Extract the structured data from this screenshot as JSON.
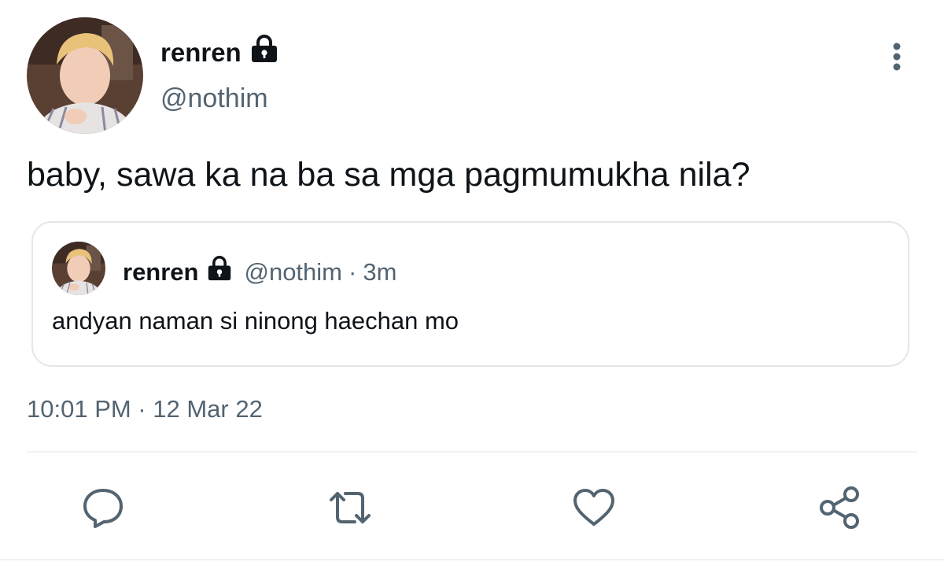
{
  "tweet": {
    "author": {
      "display_name": "renren",
      "handle": "@nothim",
      "protected_icon": "lock-icon"
    },
    "text": "baby, sawa ka na ba sa mga pagmumukha nila?",
    "timestamp": "10:01 PM · 12 Mar 22",
    "more_icon": "more-vertical-icon"
  },
  "quoted_tweet": {
    "display_name": "renren",
    "handle": "@nothim",
    "separator": "·",
    "time": "3m",
    "text": "andyan naman si ninong haechan mo"
  },
  "actions": [
    {
      "name": "reply",
      "icon": "reply-icon"
    },
    {
      "name": "retweet",
      "icon": "retweet-icon"
    },
    {
      "name": "like",
      "icon": "heart-icon"
    },
    {
      "name": "share",
      "icon": "share-icon"
    }
  ],
  "colors": {
    "text_primary": "#0f1419",
    "text_secondary": "#536471",
    "icon": "#536471",
    "border": "#e3e7ea"
  }
}
